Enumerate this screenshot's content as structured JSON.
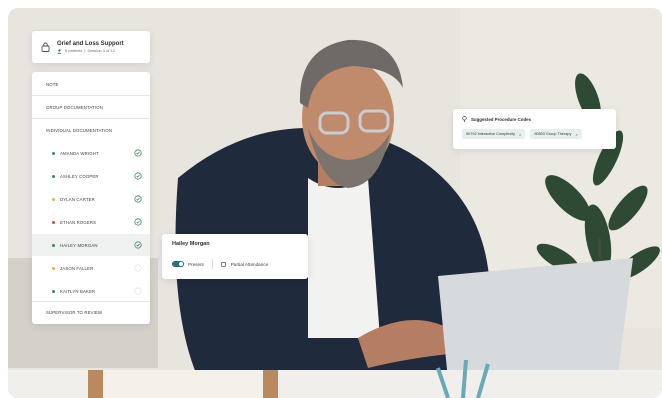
{
  "group": {
    "title": "Grief and Loss Support",
    "patients": "6 patients",
    "session": "Session 3 of 12",
    "lock_icon": "lock-icon",
    "person_icon": "person-icon"
  },
  "nav": {
    "note": "NOTE",
    "group_documentation": "GROUP DOCUMENTATION",
    "individual_documentation": "INDIVIDUAL DOCUMENTATION",
    "clients": [
      {
        "name": "AMANDA WRIGHT",
        "color": "#3c8a5a",
        "done": true
      },
      {
        "name": "ASHLEY COOPER",
        "color": "#3c8a5a",
        "done": true
      },
      {
        "name": "DYLAN CARTER",
        "color": "#e0b431",
        "done": true
      },
      {
        "name": "ETHAN ROGERS",
        "color": "#d24a3a",
        "done": true
      },
      {
        "name": "HAILEY MORGAN",
        "color": "#3c8a5a",
        "done": true
      },
      {
        "name": "JASON FALLER",
        "color": "#e0b431",
        "done": false
      },
      {
        "name": "KAITLYN BAKER",
        "color": "#3c8a5a",
        "done": false
      }
    ],
    "supervisor": "SUPERVISOR TO REVIEW"
  },
  "attendance": {
    "client_name": "Hailey Morgan",
    "present_label": "Present",
    "partial_label": "Partial Attendance",
    "present_on": true
  },
  "codes": {
    "title": "Suggested Procedure Codes",
    "items": [
      {
        "label": "90792 Interactive Complexity"
      },
      {
        "label": "90853 Group Therapy"
      }
    ]
  },
  "colors": {
    "accent": "#2c6d7e",
    "chip_bg": "#e7efec"
  }
}
